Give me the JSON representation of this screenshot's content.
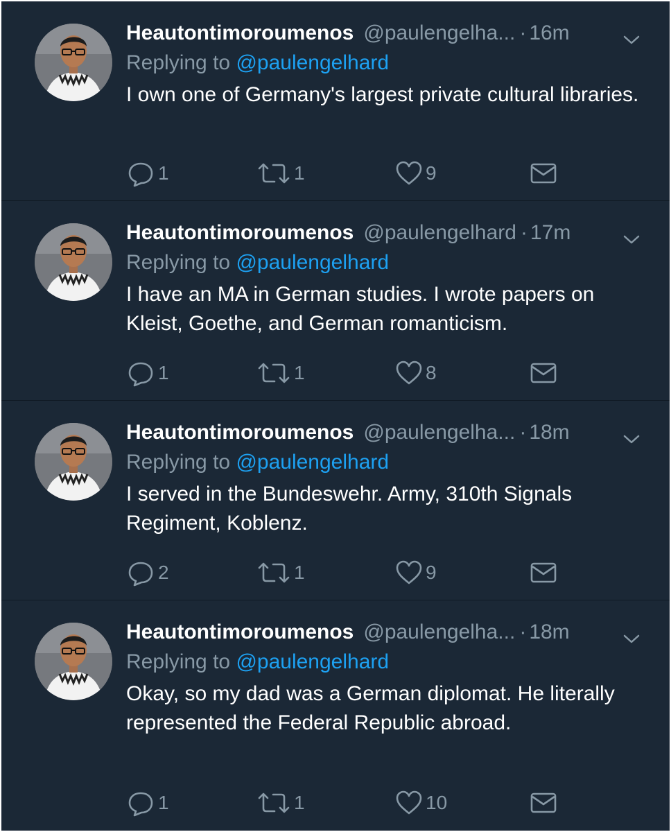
{
  "colors": {
    "background": "#1b2836",
    "name": "#ffffff",
    "muted": "#8899a6",
    "link": "#1da1f2",
    "divider": "#0f1923"
  },
  "tweets": [
    {
      "name": "Heautontimoroumenos",
      "handle": "@paulengelha...",
      "dot": "·",
      "time": "16m",
      "replying_prefix": "Replying to ",
      "replying_to": "@paulengelhard",
      "text": "I own one of Germany's largest private cultural libraries.",
      "replies": "1",
      "retweets": "1",
      "likes": "9"
    },
    {
      "name": "Heautontimoroumenos",
      "handle": "@paulengelhard",
      "dot": "·",
      "time": "17m",
      "replying_prefix": "Replying to ",
      "replying_to": "@paulengelhard",
      "text": "I have an MA in German studies. I wrote papers on Kleist, Goethe, and German romanticism.",
      "replies": "1",
      "retweets": "1",
      "likes": "8"
    },
    {
      "name": "Heautontimoroumenos",
      "handle": "@paulengelha...",
      "dot": "·",
      "time": "18m",
      "replying_prefix": "Replying to ",
      "replying_to": "@paulengelhard",
      "text": "I served in the Bundeswehr. Army, 310th Signals Regiment, Koblenz.",
      "replies": "2",
      "retweets": "1",
      "likes": "9"
    },
    {
      "name": "Heautontimoroumenos",
      "handle": "@paulengelha...",
      "dot": "·",
      "time": "18m",
      "replying_prefix": "Replying to ",
      "replying_to": "@paulengelhard",
      "text": "Okay, so my dad was a German diplomat. He literally represented the Federal Republic abroad.",
      "replies": "1",
      "retweets": "1",
      "likes": "10"
    }
  ]
}
